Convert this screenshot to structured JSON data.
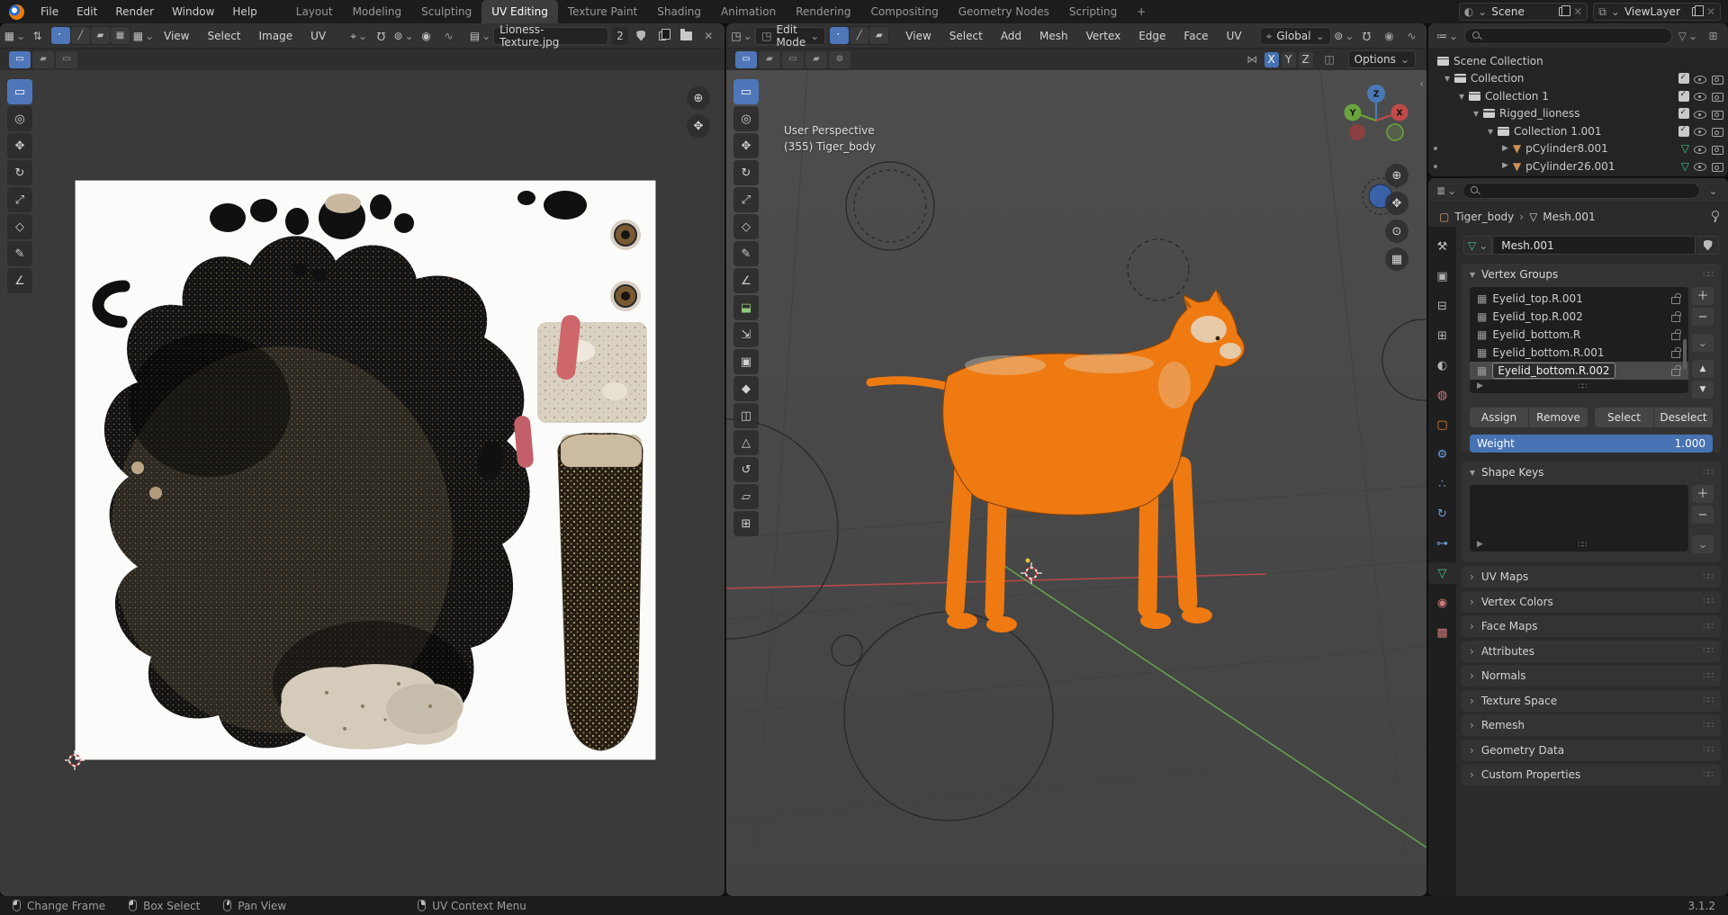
{
  "topbar": {
    "menus": [
      "File",
      "Edit",
      "Render",
      "Window",
      "Help"
    ],
    "workspaces": [
      "Layout",
      "Modeling",
      "Sculpting",
      "UV Editing",
      "Texture Paint",
      "Shading",
      "Animation",
      "Rendering",
      "Compositing",
      "Geometry Nodes",
      "Scripting"
    ],
    "active_workspace": "UV Editing",
    "add_workspace": "+",
    "scene_label": "Scene",
    "viewlayer_label": "ViewLayer"
  },
  "uv": {
    "menus": [
      "View",
      "Select",
      "Image",
      "UV"
    ],
    "image_name": "Lioness-Texture.jpg",
    "users_count": "2"
  },
  "v3d": {
    "mode": "Edit Mode",
    "menus": [
      "View",
      "Select",
      "Add",
      "Mesh",
      "Vertex",
      "Edge",
      "Face",
      "UV"
    ],
    "orientation": "Global",
    "axes": [
      "X",
      "Y",
      "Z"
    ],
    "options_label": "Options",
    "overlay_line1": "User Perspective",
    "overlay_line2": "(355) Tiger_body",
    "gizmo": {
      "x": "X",
      "y": "Y",
      "z": "Z"
    }
  },
  "outliner": {
    "rows": [
      {
        "label": "Scene Collection"
      },
      {
        "label": "Collection"
      },
      {
        "label": "Collection 1"
      },
      {
        "label": "Rigged_lioness"
      },
      {
        "label": "Collection 1.001"
      },
      {
        "label": "pCylinder8.001"
      },
      {
        "label": "pCylinder26.001"
      }
    ]
  },
  "properties": {
    "breadcrumb_object": "Tiger_body",
    "breadcrumb_sep": "›",
    "breadcrumb_data": "Mesh.001",
    "mesh_name": "Mesh.001",
    "tabs": [
      {
        "name": "tool",
        "glyph": "⚒",
        "style": "color:#c0c0c0"
      },
      {
        "name": "render",
        "glyph": "▣",
        "style": "color:#b5b5b5"
      },
      {
        "name": "output",
        "glyph": "⊟",
        "style": "color:#b5b5b5"
      },
      {
        "name": "view-layer",
        "glyph": "⊞",
        "style": "color:#b5b5b5"
      },
      {
        "name": "scene",
        "glyph": "◐",
        "style": "color:#b5b5b5"
      },
      {
        "name": "world",
        "glyph": "◍",
        "style": "color:#c97d7d"
      },
      {
        "name": "object",
        "glyph": "▢",
        "style": "color:#e0883a"
      },
      {
        "name": "modifiers",
        "glyph": "⚙",
        "style": "color:#6f9fd8"
      },
      {
        "name": "particles",
        "glyph": "∴",
        "style": "color:#6f9fd8"
      },
      {
        "name": "physics",
        "glyph": "↻",
        "style": "color:#6f9fd8"
      },
      {
        "name": "constraints",
        "glyph": "⊶",
        "style": "color:#6f9fd8"
      },
      {
        "name": "object-data",
        "glyph": "▽",
        "style": "color:#49c98f"
      },
      {
        "name": "material",
        "glyph": "◉",
        "style": "color:#c97a7a"
      },
      {
        "name": "texture",
        "glyph": "▩",
        "style": "color:#c97a7a"
      }
    ],
    "vertex_groups": {
      "title": "Vertex Groups",
      "items": [
        "Eyelid_top.R.001",
        "Eyelid_top.R.002",
        "Eyelid_bottom.R",
        "Eyelid_bottom.R.001",
        "Eyelid_bottom.R.002"
      ],
      "selected": "Eyelid_bottom.R.002",
      "buttons": [
        "Assign",
        "Remove",
        "Select",
        "Deselect"
      ],
      "weight_label": "Weight",
      "weight_value": "1.000"
    },
    "shape_keys_title": "Shape Keys",
    "collapsed_panels": [
      "UV Maps",
      "Vertex Colors",
      "Face Maps",
      "Attributes",
      "Normals",
      "Texture Space",
      "Remesh",
      "Geometry Data",
      "Custom Properties"
    ]
  },
  "statusbar": {
    "items": [
      "Change Frame",
      "Box Select",
      "Pan View",
      "UV Context Menu"
    ],
    "version": "3.1.2"
  },
  "icons": {
    "chev_down": "⌄",
    "chev_right": "›",
    "exp": "▾",
    "col": "▸",
    "tri": "▶",
    "close": "✕",
    "plus": "＋",
    "minus": "−",
    "grip": "∷∷",
    "editor_uv": "▦",
    "editor_3d": "◳",
    "editor_outliner": "≔",
    "editor_props": "≣",
    "sync": "⇅",
    "sel_vertex": "⠂",
    "sel_edge": "╱",
    "sel_face": "▰",
    "sel_island": "▦",
    "pivot": "⌖",
    "magnet": "Ω",
    "snap_target": "⊚",
    "prop_edit": "◉",
    "falloff": "∿",
    "image": "▤",
    "mode_edit": "◳",
    "orientation": "⌖",
    "mirror": "⋈",
    "xray": "◫",
    "vgroup": "▦",
    "mesh_obj": "▼",
    "mesh_data": "▽",
    "object": "▢",
    "zoom_in": "⊕",
    "pan": "✥",
    "camera_view": "⊙",
    "ortho_grid": "▦",
    "funnel": "▽",
    "new_coll": "⊞",
    "collapse": "‹",
    "uv_tools": [
      "▭",
      "◎",
      "✥",
      "↻",
      "⤢",
      "◇",
      "✎",
      "∠"
    ],
    "v3d_tools": [
      "▭",
      "◎",
      "✥",
      "↻",
      "⤢",
      "◇",
      "✎",
      "∠",
      "⬓",
      "⇲",
      "▣",
      "◆",
      "◫",
      "△",
      "↺",
      "▱",
      "⊞"
    ]
  },
  "colors": {
    "accent_blue": "#4772b3",
    "selection_orange": "#f27d17",
    "header": "#323232",
    "viewport_bg": "#484848"
  }
}
